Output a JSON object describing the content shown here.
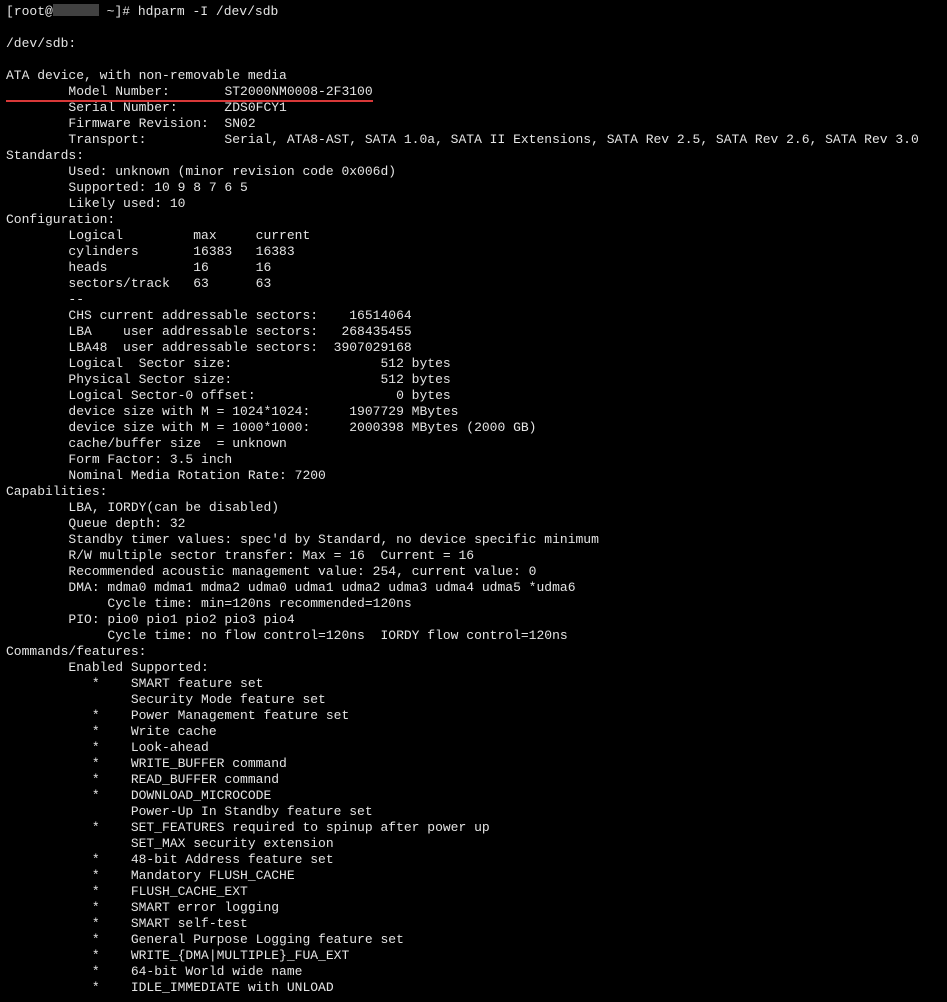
{
  "prompt": {
    "user": "root",
    "host_hidden": true,
    "cwd": "~",
    "command": "hdparm -I /dev/sdb"
  },
  "device_header": "/dev/sdb:",
  "blank": "",
  "intro": "ATA device, with non-removable media",
  "id": {
    "model_label": "        Model Number:       ",
    "model_value": "ST2000NM0008-2F3100",
    "serial": "        Serial Number:      ZDS0FCY1",
    "firmware": "        Firmware Revision:  SN02",
    "transport": "        Transport:          Serial, ATA8-AST, SATA 1.0a, SATA II Extensions, SATA Rev 2.5, SATA Rev 2.6, SATA Rev 3.0"
  },
  "standards": {
    "header": "Standards:",
    "used": "        Used: unknown (minor revision code 0x006d)",
    "supported": "        Supported: 10 9 8 7 6 5",
    "likely": "        Likely used: 10"
  },
  "config": {
    "header": "Configuration:",
    "hdr_line": "        Logical         max     current",
    "cyl": "        cylinders       16383   16383",
    "heads": "        heads           16      16",
    "spt": "        sectors/track   63      63",
    "dash": "        --",
    "chs": "        CHS current addressable sectors:    16514064",
    "lba": "        LBA    user addressable sectors:   268435455",
    "lba48": "        LBA48  user addressable sectors:  3907029168",
    "lsec": "        Logical  Sector size:                   512 bytes",
    "psec": "        Physical Sector size:                   512 bytes",
    "loff": "        Logical Sector-0 offset:                  0 bytes",
    "m1024": "        device size with M = 1024*1024:     1907729 MBytes",
    "m1000": "        device size with M = 1000*1000:     2000398 MBytes (2000 GB)",
    "cache": "        cache/buffer size  = unknown",
    "form": "        Form Factor: 3.5 inch",
    "rpm": "        Nominal Media Rotation Rate: 7200"
  },
  "caps": {
    "header": "Capabilities:",
    "l1": "        LBA, IORDY(can be disabled)",
    "l2": "        Queue depth: 32",
    "l3": "        Standby timer values: spec'd by Standard, no device specific minimum",
    "l4": "        R/W multiple sector transfer: Max = 16  Current = 16",
    "l5": "        Recommended acoustic management value: 254, current value: 0",
    "l6": "        DMA: mdma0 mdma1 mdma2 udma0 udma1 udma2 udma3 udma4 udma5 *udma6",
    "l7": "             Cycle time: min=120ns recommended=120ns",
    "l8": "        PIO: pio0 pio1 pio2 pio3 pio4",
    "l9": "             Cycle time: no flow control=120ns  IORDY flow control=120ns"
  },
  "cmds": {
    "header": "Commands/features:",
    "sub": "        Enabled Supported:",
    "f01": "           *    SMART feature set",
    "f02": "                Security Mode feature set",
    "f03": "           *    Power Management feature set",
    "f04": "           *    Write cache",
    "f05": "           *    Look-ahead",
    "f06": "           *    WRITE_BUFFER command",
    "f07": "           *    READ_BUFFER command",
    "f08": "           *    DOWNLOAD_MICROCODE",
    "f09": "                Power-Up In Standby feature set",
    "f10": "           *    SET_FEATURES required to spinup after power up",
    "f11": "                SET_MAX security extension",
    "f12": "           *    48-bit Address feature set",
    "f13": "           *    Mandatory FLUSH_CACHE",
    "f14": "           *    FLUSH_CACHE_EXT",
    "f15": "           *    SMART error logging",
    "f16": "           *    SMART self-test",
    "f17": "           *    General Purpose Logging feature set",
    "f18": "           *    WRITE_{DMA|MULTIPLE}_FUA_EXT",
    "f19": "           *    64-bit World wide name",
    "f20": "           *    IDLE_IMMEDIATE with UNLOAD"
  }
}
